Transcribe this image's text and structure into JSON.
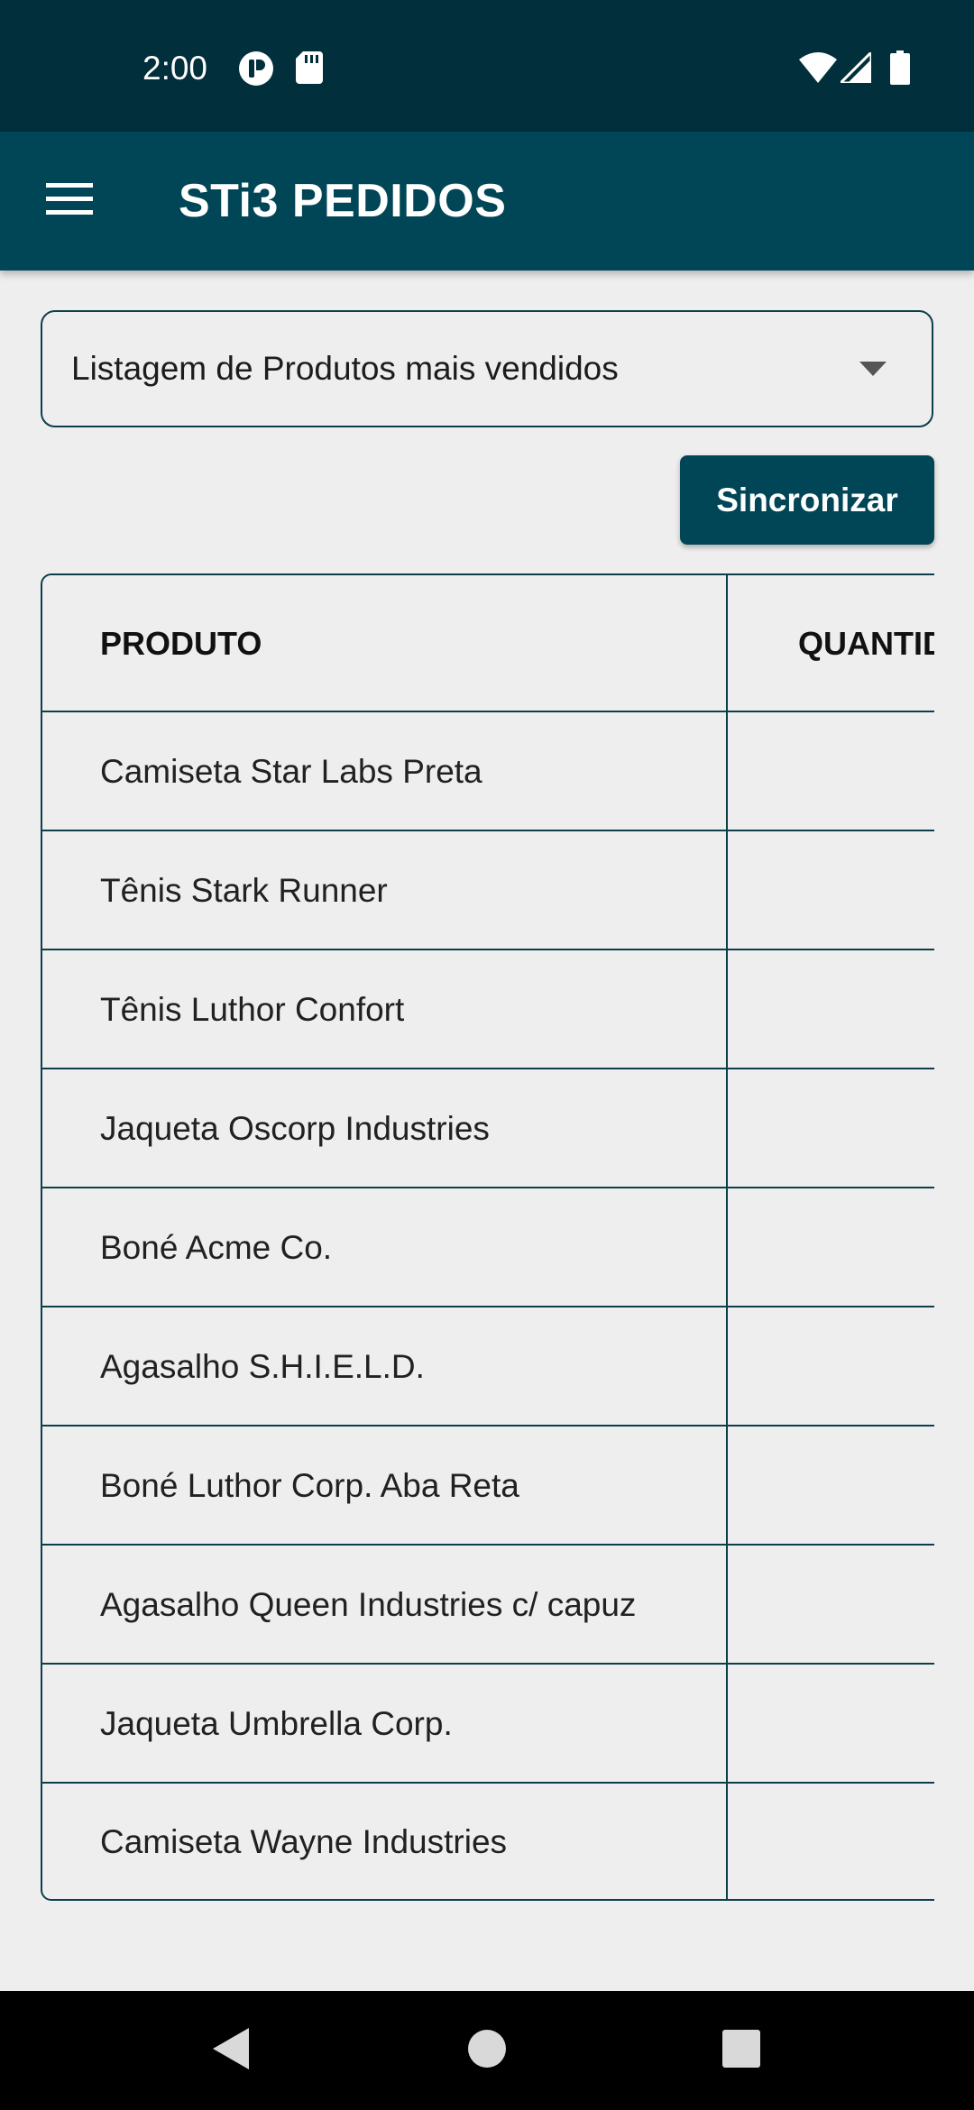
{
  "status_bar": {
    "time": "2:00",
    "left_icons": [
      "notification-app-icon",
      "sd-card-icon"
    ],
    "right_icons": [
      "wifi-icon",
      "cell-signal-icon",
      "battery-icon"
    ]
  },
  "app_bar": {
    "menu_icon": "hamburger-menu-icon",
    "title": "STi3 PEDIDOS"
  },
  "report_select": {
    "selected": "Listagem de Produtos mais vendidos",
    "icon": "dropdown-caret-icon"
  },
  "sync_button": {
    "label": "Sincronizar"
  },
  "table": {
    "columns": [
      "PRODUTO",
      "QUANTIDADE"
    ],
    "rows": [
      {
        "product": "Camiseta Star Labs Preta",
        "quantity": ""
      },
      {
        "product": "Tênis Stark Runner",
        "quantity": ""
      },
      {
        "product": "Tênis Luthor Confort",
        "quantity": ""
      },
      {
        "product": "Jaqueta Oscorp Industries",
        "quantity": ""
      },
      {
        "product": "Boné Acme Co.",
        "quantity": ""
      },
      {
        "product": "Agasalho S.H.I.E.L.D.",
        "quantity": ""
      },
      {
        "product": "Boné Luthor Corp. Aba Reta",
        "quantity": ""
      },
      {
        "product": "Agasalho Queen Industries c/ capuz",
        "quantity": ""
      },
      {
        "product": "Jaqueta Umbrella Corp.",
        "quantity": ""
      },
      {
        "product": "Camiseta Wayne Industries",
        "quantity": ""
      }
    ]
  },
  "nav_bar": {
    "buttons": [
      "back-icon",
      "home-icon",
      "recents-icon"
    ]
  },
  "colors": {
    "status_bar": "#012f3c",
    "app_bar": "#004656",
    "accent": "#004656",
    "border": "#0d3f4b",
    "background": "#eeeeee"
  }
}
